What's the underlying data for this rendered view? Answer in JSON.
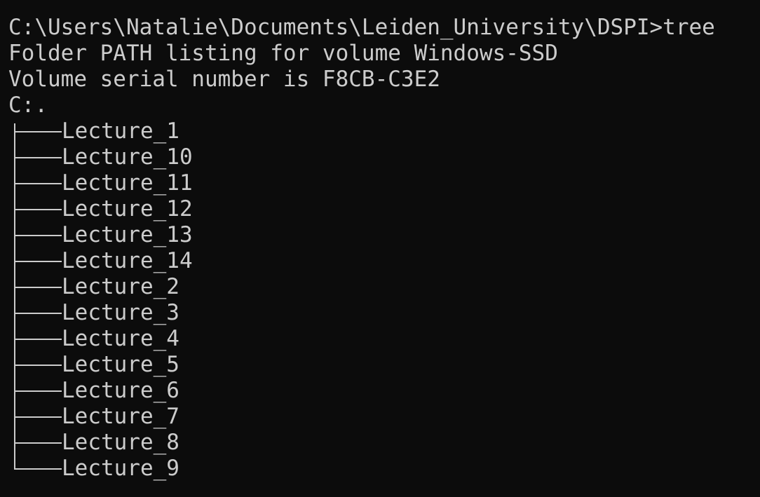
{
  "terminal": {
    "prompt_command": "C:\\Users\\Natalie\\Documents\\Leiden_University\\DSPI>tree",
    "header_line": "Folder PATH listing for volume Windows-SSD",
    "serial_line": "Volume serial number is F8CB-C3E2",
    "root": "C:.",
    "folders": [
      "Lecture_1",
      "Lecture_10",
      "Lecture_11",
      "Lecture_12",
      "Lecture_13",
      "Lecture_14",
      "Lecture_2",
      "Lecture_3",
      "Lecture_4",
      "Lecture_5",
      "Lecture_6",
      "Lecture_7",
      "Lecture_8",
      "Lecture_9"
    ]
  }
}
